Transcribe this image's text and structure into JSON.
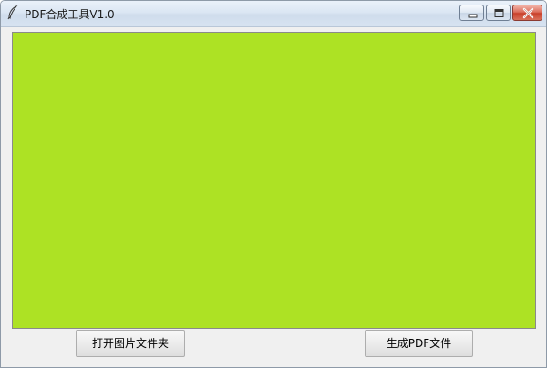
{
  "window": {
    "title": "PDF合成工具V1.0",
    "icon": "feather-icon",
    "controls": {
      "minimize_icon": "minimize-icon",
      "maximize_icon": "maximize-icon",
      "close_icon": "close-icon"
    }
  },
  "canvas": {
    "background_color": "#ade224"
  },
  "buttons": {
    "open_folder_label": "打开图片文件夹",
    "generate_pdf_label": "生成PDF文件"
  }
}
